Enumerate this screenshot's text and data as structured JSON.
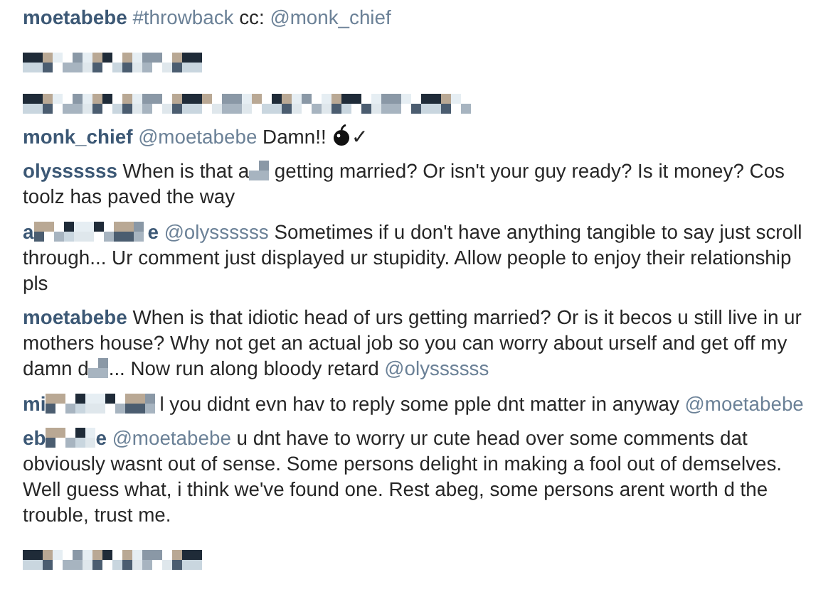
{
  "comments": [
    {
      "segments": [
        {
          "kind": "user",
          "text": "moetabebe"
        },
        {
          "kind": "mention",
          "text": "#throwback"
        },
        {
          "kind": "text",
          "text": " cc: "
        },
        {
          "kind": "mention",
          "text": "@monk_chief"
        }
      ]
    },
    {
      "segments": [
        {
          "kind": "blurl"
        }
      ]
    },
    {
      "segments": [
        {
          "kind": "blurxl"
        }
      ]
    },
    {
      "segments": [
        {
          "kind": "user",
          "text": "monk_chief"
        },
        {
          "kind": "mention",
          "text": "@moetabebe"
        },
        {
          "kind": "text",
          "text": " Damn!! "
        },
        {
          "kind": "emoji"
        },
        {
          "kind": "text",
          "text": "✓"
        }
      ]
    },
    {
      "segments": [
        {
          "kind": "user",
          "text": "olyssssss"
        },
        {
          "kind": "text",
          "text": " When is that a"
        },
        {
          "kind": "blurxs"
        },
        {
          "kind": "text",
          "text": " getting married? Or isn't your guy ready? Is it money? Cos toolz has paved the way"
        }
      ]
    },
    {
      "segments": [
        {
          "kind": "user",
          "text": "a"
        },
        {
          "kind": "blurm"
        },
        {
          "kind": "user",
          "text": "e"
        },
        {
          "kind": "mention",
          "text": "@olyssssss"
        },
        {
          "kind": "text",
          "text": " Sometimes if u don't have anything tangible to say just scroll through... Ur comment just displayed ur stupidity. Allow people to enjoy their relationship pls"
        }
      ]
    },
    {
      "segments": [
        {
          "kind": "user",
          "text": "moetabebe"
        },
        {
          "kind": "text",
          "text": " When is that idiotic head of urs getting married? Or is it becos u still live in ur mothers house? Why not get an actual job so you can worry about urself and get off my damn d"
        },
        {
          "kind": "blurxs"
        },
        {
          "kind": "text",
          "text": "... Now run along bloody retard "
        },
        {
          "kind": "mention",
          "text": "@olyssssss"
        }
      ]
    },
    {
      "segments": [
        {
          "kind": "user",
          "text": "mi"
        },
        {
          "kind": "blurm"
        },
        {
          "kind": "text",
          "text": "l you didnt evn hav to reply some pple dnt matter in anyway "
        },
        {
          "kind": "mention",
          "text": "@moetabebe"
        }
      ]
    },
    {
      "segments": [
        {
          "kind": "user",
          "text": "eb"
        },
        {
          "kind": "blurs"
        },
        {
          "kind": "user",
          "text": "e"
        },
        {
          "kind": "mention",
          "text": "@moetabebe"
        },
        {
          "kind": "text",
          "text": " u dnt have to worry ur cute head over some comments dat obviously wasnt out of sense. Some persons delight in making a fool out of demselves. Well guess what, i think we've found one. Rest abeg, some persons arent worth d the trouble, trust me."
        }
      ]
    },
    {
      "segments": [
        {
          "kind": "blurl"
        }
      ]
    }
  ]
}
